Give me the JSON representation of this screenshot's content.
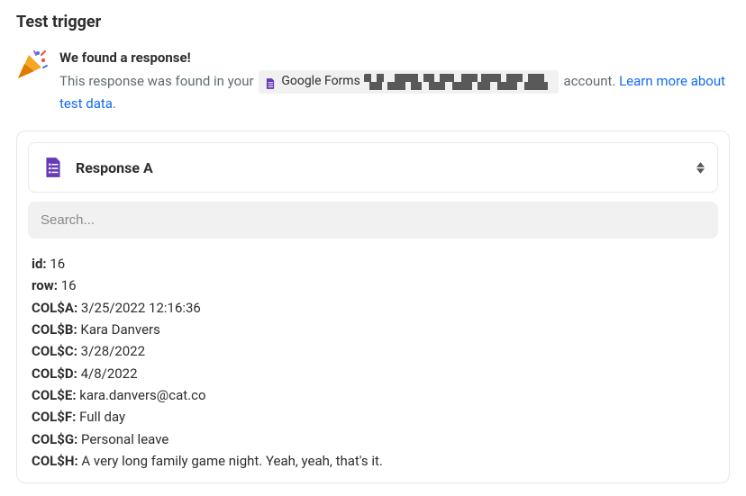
{
  "page_title": "Test trigger",
  "found": {
    "title": "We found a response!",
    "prefix": "This response was found in your ",
    "account_service": "Google Forms",
    "suffix": " account. ",
    "learn_more": "Learn more about test data",
    "period": "."
  },
  "response": {
    "title": "Response A",
    "search_placeholder": "Search..."
  },
  "fields": [
    {
      "key": "id:",
      "value": "16"
    },
    {
      "key": "row:",
      "value": "16"
    },
    {
      "key": "COL$A:",
      "value": "3/25/2022 12:16:36"
    },
    {
      "key": "COL$B:",
      "value": "Kara Danvers"
    },
    {
      "key": "COL$C:",
      "value": "3/28/2022"
    },
    {
      "key": "COL$D:",
      "value": "4/8/2022"
    },
    {
      "key": "COL$E:",
      "value": "kara.danvers@cat.co"
    },
    {
      "key": "COL$F:",
      "value": "Full day"
    },
    {
      "key": "COL$G:",
      "value": "Personal leave"
    },
    {
      "key": "COL$H:",
      "value": "A very long family game night. Yeah, yeah, that's it."
    }
  ]
}
